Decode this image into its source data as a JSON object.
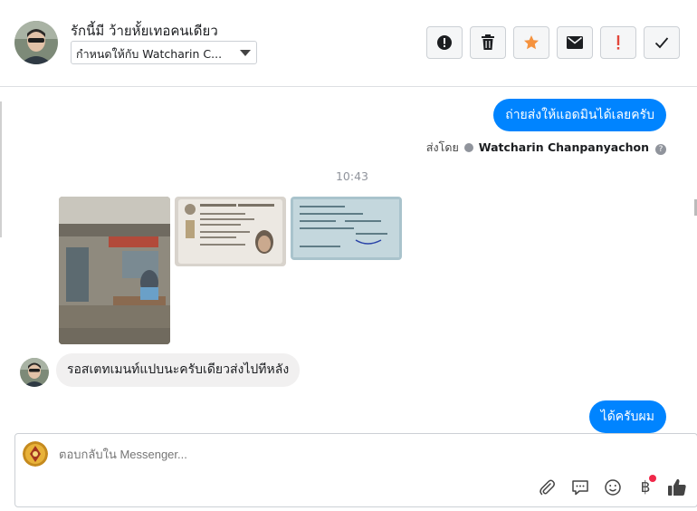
{
  "header": {
    "contact_name": "รักนี้มี ว้ายหั้ยเทอคนเดียว",
    "assign_value": "กำหนดให้กับ Watcharin C...",
    "actions": [
      {
        "name": "spam-button",
        "icon": "exclamation-circle-icon"
      },
      {
        "name": "delete-button",
        "icon": "trash-icon"
      },
      {
        "name": "star-button",
        "icon": "star-icon",
        "color": "#f5923e"
      },
      {
        "name": "mark-unread-button",
        "icon": "envelope-icon"
      },
      {
        "name": "follow-up-button",
        "icon": "exclamation-mark-icon",
        "color": "#e2473b"
      },
      {
        "name": "mark-done-button",
        "icon": "check-icon"
      }
    ]
  },
  "messages": {
    "outgoing_1": "ถ่ายส่งให้แอดมินได้เลยครับ",
    "sent_by_prefix": "ส่งโดย",
    "sent_by_name": "Watcharin Chanpanyachon",
    "timestamp": "10:43",
    "incoming_1": "รอสเตทเมนท์แปบนะครับเดียวส่งไปทีหลัง",
    "outgoing_2": "ได้ครับผม"
  },
  "composer": {
    "placeholder": "ตอบกลับใน Messenger...",
    "tools": [
      "paperclip-icon",
      "chat-bubble-icon",
      "smiley-icon",
      "baht-icon",
      "thumbs-up-icon"
    ]
  },
  "colors": {
    "accent": "#0084ff",
    "incoming_bubble": "#f1f0f0",
    "star": "#f5923e",
    "follow_up": "#e2473b"
  }
}
